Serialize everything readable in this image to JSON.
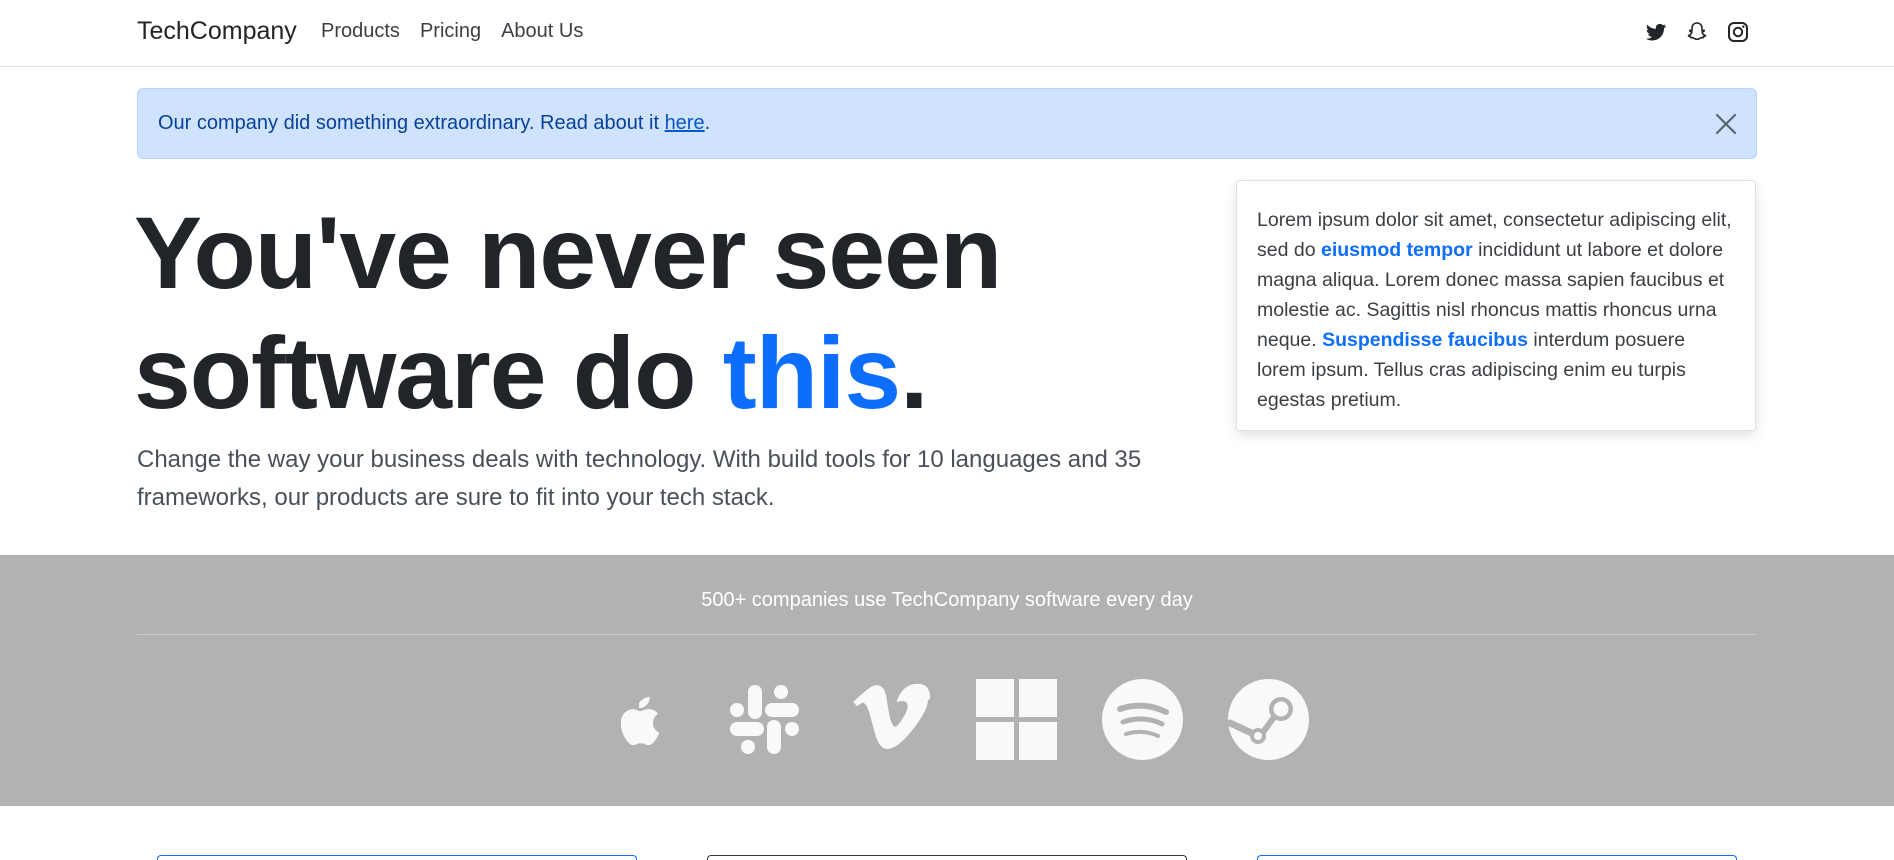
{
  "navbar": {
    "brand": "TechCompany",
    "links": [
      "Products",
      "Pricing",
      "About Us"
    ],
    "social_icons": [
      "twitter-icon",
      "snapchat-icon",
      "instagram-icon"
    ]
  },
  "alert": {
    "text_before": "Our company did something extraordinary. Read about it ",
    "link": "here",
    "text_after": "."
  },
  "hero": {
    "line1": "You've never seen",
    "line2_start": "software do ",
    "line2_accent": "this",
    "line2_end": ".",
    "lead": "Change the way your business deals with technology. With build tools for 10 languages and 35 frameworks, our products are sure to fit into your tech stack."
  },
  "card": {
    "p1": "Lorem ipsum dolor sit amet, consectetur adipiscing elit, sed do ",
    "b1": "eiusmod tempor",
    "p2": " incididunt ut labore et dolore magna aliqua. Lorem donec massa sapien faucibus et molestie ac. Sagittis nisl rhoncus mattis rhoncus urna neque. ",
    "b2": "Suspendisse faucibus",
    "p3": " interdum posuere lorem ipsum. Tellus cras adipiscing enim eu turpis egestas pretium."
  },
  "band": {
    "text": "500+ companies use TechCompany software every day",
    "logos": [
      "apple-icon",
      "slack-icon",
      "vimeo-icon",
      "windows-icon",
      "spotify-icon",
      "steam-icon"
    ]
  },
  "colors": {
    "accent": "#0d6efd",
    "alert_bg": "#cfe2ff",
    "band_bg": "#b2b2b2"
  }
}
